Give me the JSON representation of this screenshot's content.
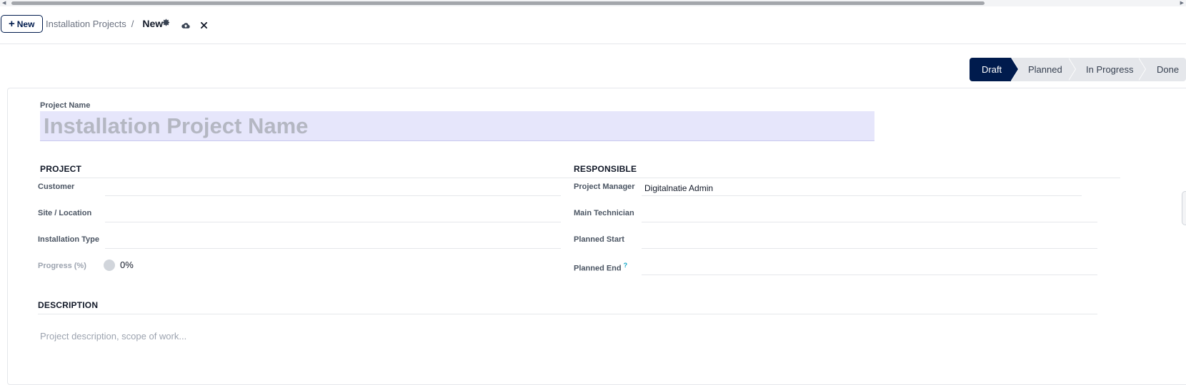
{
  "control_panel": {
    "new_button_label": "New",
    "breadcrumb_parent": "Installation Projects",
    "breadcrumb_separator": "/",
    "breadcrumb_current": "New",
    "icons": [
      "gear-icon",
      "cloud-upload-icon",
      "close-icon"
    ]
  },
  "statusbar": {
    "stages": [
      "Draft",
      "Planned",
      "In Progress",
      "Done"
    ],
    "active": "Draft",
    "active_color": "#001b4d",
    "inactive_color": "#e5e7eb"
  },
  "form": {
    "name_label": "Project Name",
    "name_placeholder": "Installation Project Name",
    "name_bg_color": "#e6e6fb",
    "project_group": {
      "title": "PROJECT",
      "customer_label": "Customer",
      "customer_value": "",
      "site_label": "Site / Location",
      "site_value": "",
      "type_label": "Installation Type",
      "type_value": "",
      "progress_label": "Progress (%)",
      "progress_value": "0%"
    },
    "responsible_group": {
      "title": "RESPONSIBLE",
      "manager_label": "Project Manager",
      "manager_value": "Digitalnatie Admin",
      "technician_label": "Main Technician",
      "technician_value": "",
      "start_label": "Planned Start",
      "start_value": "",
      "end_label": "Planned End",
      "end_help": "?",
      "end_value": ""
    },
    "description_group": {
      "title": "DESCRIPTION",
      "placeholder": "Project description, scope of work..."
    }
  }
}
